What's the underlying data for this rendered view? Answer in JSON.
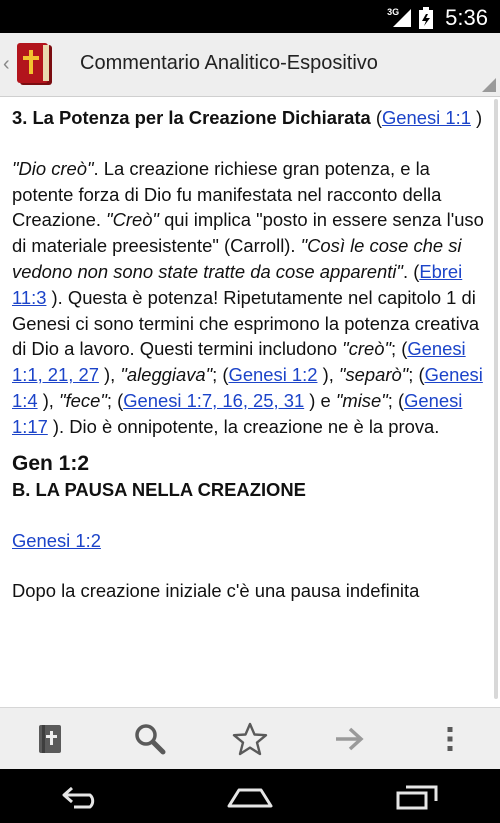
{
  "status_bar": {
    "network": "3G",
    "time": "5:36"
  },
  "action_bar": {
    "title": "Commentario Analitico-Espositivo"
  },
  "content": {
    "section_heading": "3. La Potenza per la Creazione Dichiarata",
    "section_ref_open": " (",
    "section_ref": "Genesi 1:1",
    "section_ref_close": " )",
    "p1": {
      "q1": "\"Dio creò\"",
      "t1": ". La creazione richiese gran potenza, e la potente forza di Dio fu manifestata nel racconto della Creazione. ",
      "q2": "\"Creò\"",
      "t2": " qui implica \"posto in essere senza l'uso di materiale preesistente\" (Carroll). ",
      "q3": "\"Così le cose che si vedono non sono state tratte da cose apparenti\"",
      "t3": ". (",
      "link1": "Ebrei 11:3",
      "t4": " ). Questa è potenza! Ripetutamente nel capitolo 1 di Genesi ci sono termini che esprimono la potenza creativa di Dio a lavoro. Questi termini includono ",
      "q4": "\"creò\"",
      "t5": "; (",
      "link2": "Genesi 1:1, 21, 27",
      "t6": " ), ",
      "q5": "\"aleggiava\"",
      "t7": "; (",
      "link3": "Genesi 1:2",
      "t8": " ), ",
      "q6": "\"separò\"",
      "t9": "; (",
      "link4": "Genesi 1:4",
      "t10": " ), ",
      "q7": "\"fece\"",
      "t11": "; (",
      "link5": "Genesi 1:7, 16, 25, 31",
      "t12": " ) e ",
      "q8": "\"mise\"",
      "t13": "; (",
      "link6": "Genesi 1:17",
      "t14": " ). Dio è onnipotente, la creazione ne è la prova."
    },
    "gen_heading": "Gen 1:2",
    "sub_heading": "B. LA PAUSA NELLA CREAZIONE",
    "ref_link": "Genesi 1:2",
    "p2": "Dopo la creazione iniziale c'è una pausa indefinita"
  },
  "toolbar": {
    "items": [
      "bible-icon",
      "search-icon",
      "star-icon",
      "forward-arrow-icon",
      "overflow-menu-icon"
    ]
  },
  "colors": {
    "link": "#1c44c9",
    "action_bar": "#eeeeee",
    "toolbar": "#efefef",
    "book_red": "#b2141c"
  }
}
